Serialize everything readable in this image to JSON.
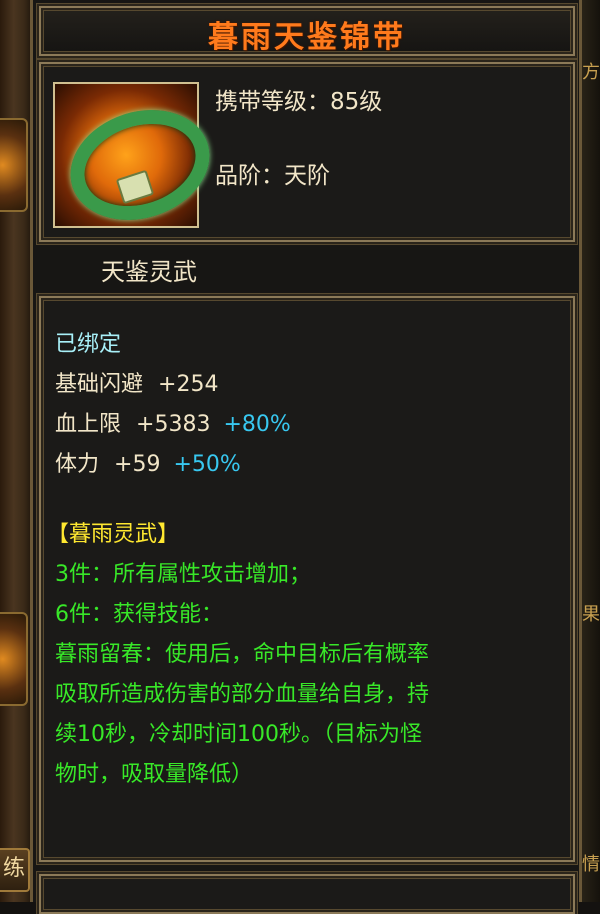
{
  "item": {
    "name": "暮雨天鉴锦带",
    "level_label": "携带等级：85级",
    "grade_label": "品阶：天阶",
    "set_name": "天鉴灵武"
  },
  "details": {
    "bound": "已绑定",
    "stats": [
      {
        "label": "基础闪避",
        "value": "+254",
        "bonus": ""
      },
      {
        "label": "血上限",
        "value": "+5383",
        "bonus": "+80%"
      },
      {
        "label": "体力",
        "value": "+59",
        "bonus": "+50%"
      }
    ],
    "set_title": "【暮雨灵武】",
    "set_bonus_3": "3件：所有属性攻击增加；",
    "set_bonus_6": "6件：获得技能：",
    "skill_lines": [
      "暮雨留春：使用后，命中目标后有概率",
      "吸取所造成伤害的部分血量给自身，持",
      "续10秒，冷却时间100秒。（目标为怪",
      "物时，吸取量降低）"
    ]
  },
  "side": {
    "left_button": "练",
    "right_chars": [
      "方",
      "果",
      "情"
    ]
  },
  "colors": {
    "title": "#ff7a1c",
    "bound": "#a8f0f8",
    "stat": "#f2e6c8",
    "bonus": "#38c8f0",
    "set_title": "#ffe830",
    "set_text": "#38e828"
  }
}
